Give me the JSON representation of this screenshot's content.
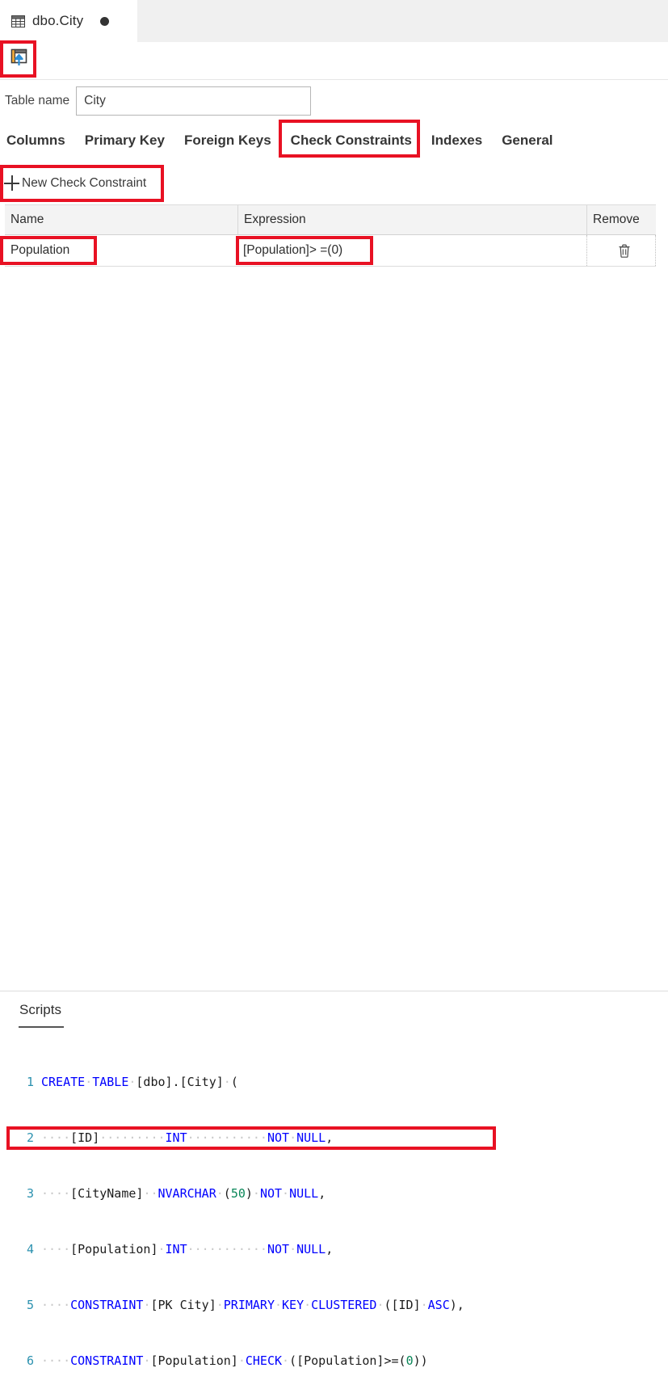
{
  "tab": {
    "icon": "table-grid-icon",
    "label": "dbo.City",
    "dirty_indicator": "●"
  },
  "toolbar": {
    "update_button_icon": "publish-update-icon",
    "update_button_tooltip": "Update"
  },
  "table_name": {
    "label": "Table name",
    "value": "City"
  },
  "pivot": {
    "items": [
      {
        "label": "Columns",
        "selected": false
      },
      {
        "label": "Primary Key",
        "selected": false
      },
      {
        "label": "Foreign Keys",
        "selected": false
      },
      {
        "label": "Check Constraints",
        "selected": true
      },
      {
        "label": "Indexes",
        "selected": false
      },
      {
        "label": "General",
        "selected": false
      }
    ]
  },
  "new_constraint": {
    "icon": "plus-icon",
    "label": "New Check Constraint"
  },
  "grid": {
    "columns": [
      "Name",
      "Expression",
      "Remove"
    ],
    "rows": [
      {
        "name": "Population",
        "expression": "[Population]> =(0)",
        "remove_icon": "trash-icon"
      }
    ]
  },
  "scripts": {
    "title": "Scripts",
    "lines": [
      {
        "number": "1",
        "text": "CREATE TABLE [dbo].[City] ("
      },
      {
        "number": "2",
        "text": "    [ID]         INT          NOT NULL,"
      },
      {
        "number": "3",
        "text": "    [CityName]   NVARCHAR (50) NOT NULL,"
      },
      {
        "number": "4",
        "text": "    [Population] INT          NOT NULL,"
      },
      {
        "number": "5",
        "text": "    CONSTRAINT [PK City] PRIMARY KEY CLUSTERED ([ID] ASC),"
      },
      {
        "number": "6",
        "text": "    CONSTRAINT [Population] CHECK ([Population]>=(0))"
      }
    ]
  },
  "annotations": {
    "color": "#e81123",
    "highlights": [
      "update-toolbar-button",
      "check-constraints-tab",
      "new-check-constraint-button",
      "constraint-name-cell",
      "constraint-expression-cell",
      "script-line-6"
    ]
  }
}
